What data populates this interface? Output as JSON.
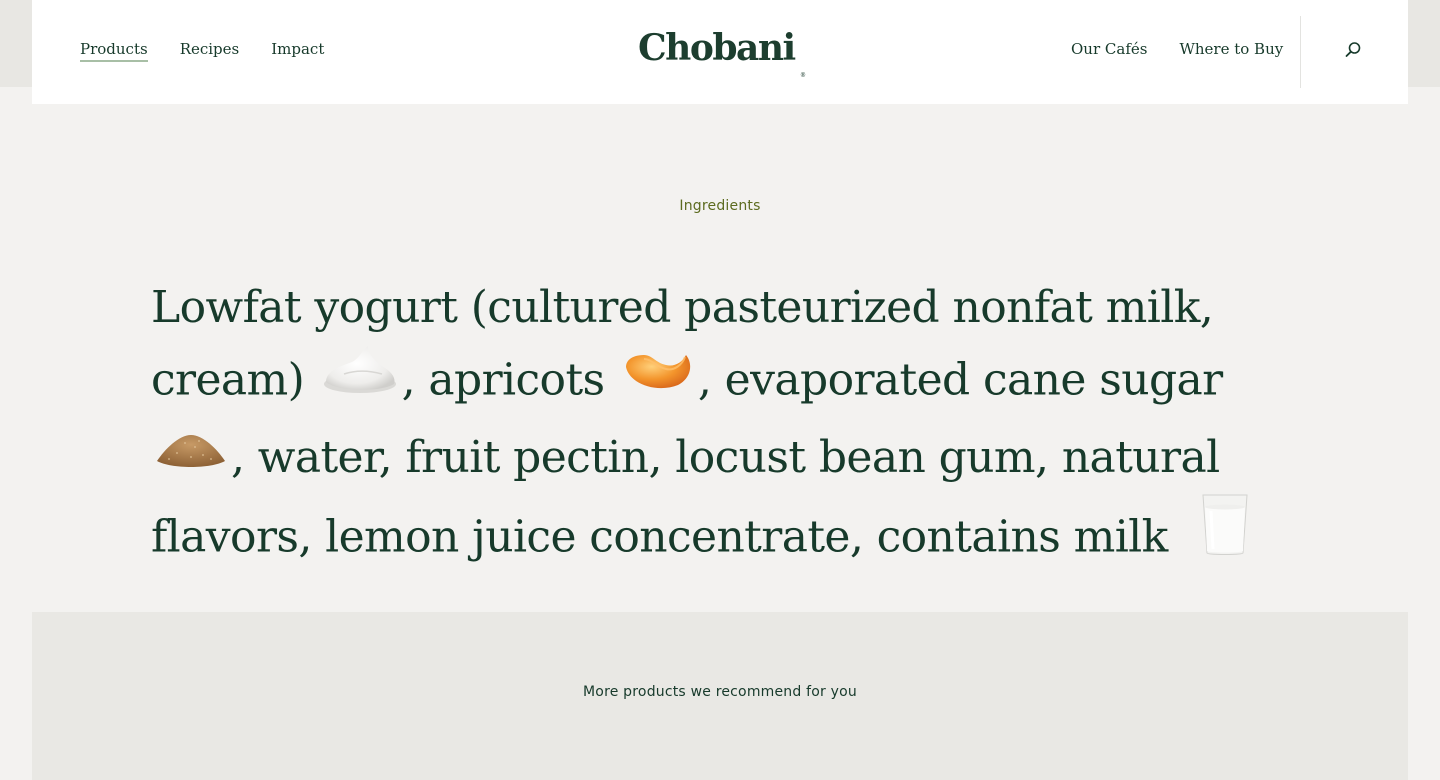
{
  "header": {
    "logo": "Chobani",
    "logo_mark": "®",
    "nav_left": [
      {
        "label": "Products",
        "active": true
      },
      {
        "label": "Recipes",
        "active": false
      },
      {
        "label": "Impact",
        "active": false
      }
    ],
    "nav_right": [
      {
        "label": "Our Cafés"
      },
      {
        "label": "Where to Buy"
      }
    ],
    "search_icon": "search-icon"
  },
  "ingredients": {
    "eyebrow": "Ingredients",
    "segments": {
      "s1": "Lowfat yogurt (cultured pasteurized nonfat milk, cream)",
      "s2": ", apricots",
      "s3": ", evaporated cane sugar",
      "s4": ", water, fruit pectin, locust bean gum, natural flavors, lemon juice concentrate, contains milk",
      "s5": "."
    },
    "icons": [
      "cream-icon",
      "apricot-icon",
      "cane-sugar-icon",
      "milk-glass-icon"
    ]
  },
  "recommendations": {
    "title": "More products we recommend for you"
  },
  "colors": {
    "page_bg": "#f3f2f0",
    "text_primary": "#173a2b",
    "eyebrow": "#5c6b1f",
    "active_underline": "#a8bfa6",
    "recommend_bg": "#e9e8e4"
  }
}
